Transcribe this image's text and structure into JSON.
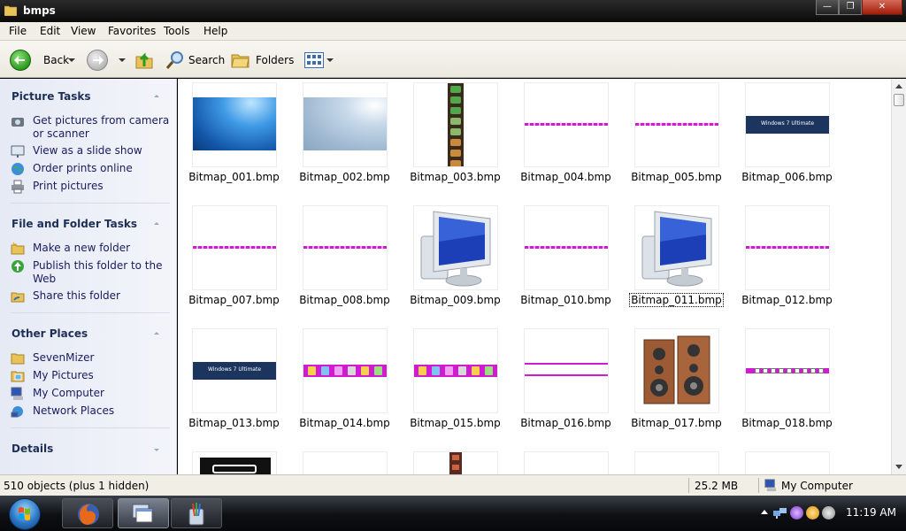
{
  "window": {
    "title": "bmps"
  },
  "menu": [
    "File",
    "Edit",
    "View",
    "Favorites",
    "Tools",
    "Help"
  ],
  "toolbar": {
    "back": "Back",
    "search": "Search",
    "folders": "Folders"
  },
  "left_panel": {
    "picture_tasks": {
      "title": "Picture Tasks",
      "items": [
        "Get pictures from camera or scanner",
        "View as a slide show",
        "Order prints online",
        "Print pictures"
      ]
    },
    "file_folder_tasks": {
      "title": "File and Folder Tasks",
      "items": [
        "Make a new folder",
        "Publish this folder to the Web",
        "Share this folder"
      ]
    },
    "other_places": {
      "title": "Other Places",
      "items": [
        "SevenMizer",
        "My Pictures",
        "My Computer",
        "Network Places"
      ]
    },
    "details": {
      "title": "Details"
    }
  },
  "files": [
    {
      "name": "Bitmap_001.bmp",
      "preview": "blue-wallpaper"
    },
    {
      "name": "Bitmap_002.bmp",
      "preview": "seven-wallpaper"
    },
    {
      "name": "Bitmap_003.bmp",
      "preview": "icon-strip"
    },
    {
      "name": "Bitmap_004.bmp",
      "preview": "magenta-line"
    },
    {
      "name": "Bitmap_005.bmp",
      "preview": "magenta-line"
    },
    {
      "name": "Bitmap_006.bmp",
      "preview": "windows7-banner"
    },
    {
      "name": "Bitmap_007.bmp",
      "preview": "magenta-line"
    },
    {
      "name": "Bitmap_008.bmp",
      "preview": "magenta-line"
    },
    {
      "name": "Bitmap_009.bmp",
      "preview": "computer"
    },
    {
      "name": "Bitmap_010.bmp",
      "preview": "magenta-line"
    },
    {
      "name": "Bitmap_011.bmp",
      "preview": "computer",
      "selected": true
    },
    {
      "name": "Bitmap_012.bmp",
      "preview": "magenta-line"
    },
    {
      "name": "Bitmap_013.bmp",
      "preview": "windows7-banner"
    },
    {
      "name": "Bitmap_014.bmp",
      "preview": "magenta-icons"
    },
    {
      "name": "Bitmap_015.bmp",
      "preview": "magenta-icons"
    },
    {
      "name": "Bitmap_016.bmp",
      "preview": "double-line"
    },
    {
      "name": "Bitmap_017.bmp",
      "preview": "speakers"
    },
    {
      "name": "Bitmap_018.bmp",
      "preview": "magenta-squares"
    }
  ],
  "banner_text": "Windows 7 Ultimate",
  "status": {
    "objects": "510 objects (plus 1 hidden)",
    "size": "25.2 MB",
    "location": "My Computer"
  },
  "clock": "11:19 AM",
  "colors": {
    "accent": "#1e2f56",
    "magenta": "#d01cd0",
    "wallpaper_blue": "#1874cd"
  }
}
